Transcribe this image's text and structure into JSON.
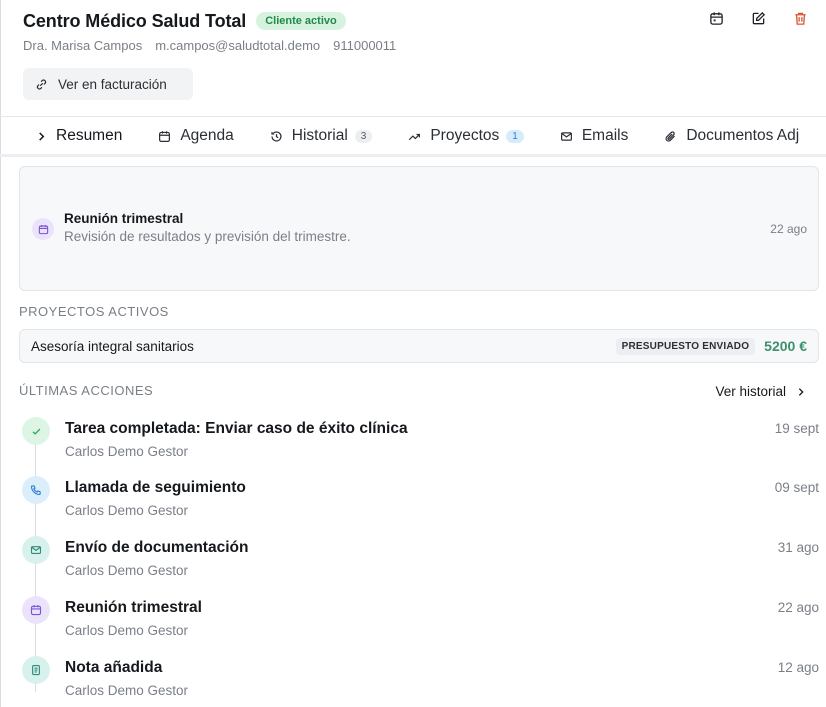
{
  "client": {
    "name": "Centro Médico Salud Total",
    "status_badge": "Cliente activo",
    "contact_name": "Dra. Marisa Campos",
    "email": "m.campos@saludtotal.demo",
    "phone": "911000011"
  },
  "header_actions": [
    "calendar-icon",
    "edit-icon",
    "trash-icon"
  ],
  "billing_button": {
    "label": "Ver en facturación",
    "icon": "link-icon"
  },
  "tabs": [
    {
      "label": "Resumen",
      "icon": "chevron-right-icon",
      "active": true
    },
    {
      "label": "Agenda",
      "icon": "calendar-icon"
    },
    {
      "label": "Historial",
      "icon": "history-icon",
      "count": "3"
    },
    {
      "label": "Proyectos",
      "icon": "trending-up-icon",
      "count": "1"
    },
    {
      "label": "Emails",
      "icon": "mail-icon"
    },
    {
      "label": "Documentos Adj",
      "icon": "paperclip-icon"
    }
  ],
  "upcoming_event": {
    "title": "Reunión trimestral",
    "description": "Revisión de resultados y previsión del trimestre.",
    "date": "22 ago"
  },
  "projects_section": {
    "label": "PROYECTOS ACTIVOS",
    "items": [
      {
        "name": "Asesoría integral sanitarios",
        "status": "PRESUPUESTO ENVIADO",
        "amount": "5200 €"
      }
    ]
  },
  "actions_section": {
    "label": "ÚLTIMAS ACCIONES",
    "history_link": "Ver historial",
    "items": [
      {
        "title": "Tarea completada: Enviar caso de éxito clínica",
        "user": "Carlos Demo Gestor",
        "date": "19 sept",
        "icon": "check-icon",
        "color": "#dcf5e4"
      },
      {
        "title": "Llamada de seguimiento",
        "user": "Carlos Demo Gestor",
        "date": "09 sept",
        "icon": "phone-icon",
        "color": "#dbeefc"
      },
      {
        "title": "Envío de documentación",
        "user": "Carlos Demo Gestor",
        "date": "31 ago",
        "icon": "mail-icon",
        "color": "#d8f1ec"
      },
      {
        "title": "Reunión trimestral",
        "user": "Carlos Demo Gestor",
        "date": "22 ago",
        "icon": "calendar-icon",
        "color": "#ebe3fb"
      },
      {
        "title": "Nota añadida",
        "user": "Carlos Demo Gestor",
        "date": "12 ago",
        "icon": "note-icon",
        "color": "#d8f1ec"
      }
    ]
  },
  "colors": {
    "accent": "#2f7fd1",
    "success": "#1f8a47",
    "amount": "#3e8f6b",
    "danger": "#d9542f"
  }
}
